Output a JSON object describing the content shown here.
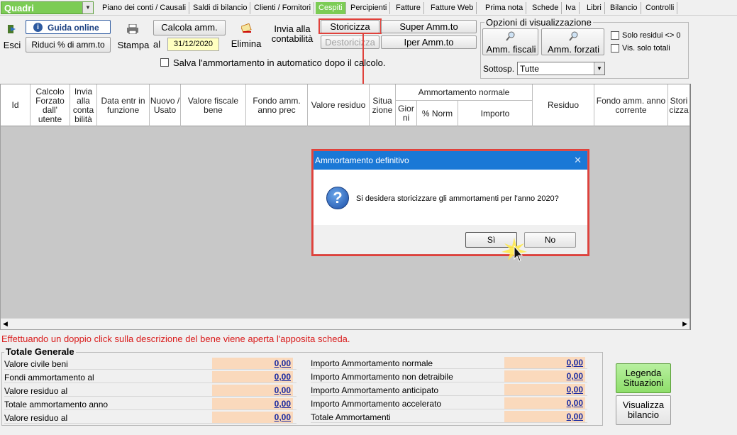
{
  "menu": {
    "quadri": "Quadri",
    "items": [
      "Piano dei conti / Causali",
      "Saldi di bilancio",
      "Clienti / Fornitori",
      "Cespiti",
      "Percipienti",
      "Fatture",
      "Fatture Web",
      "Prima nota",
      "Schede",
      "Iva",
      "Libri",
      "Bilancio",
      "Controlli"
    ],
    "active": "Cespiti"
  },
  "toolbar": {
    "esci": "Esci",
    "guida": "Guida online",
    "riduci": "Riduci % di amm.to",
    "stampa": "Stampa",
    "calcola": "Calcola amm.",
    "al": "al",
    "date": "31/12/2020",
    "elimina": "Elimina",
    "invia": "Invia alla contabilità",
    "storicizza": "Storicizza",
    "destoricizza": "Destoricizza",
    "super": "Super Amm.to",
    "iper": "Iper Amm.to",
    "salva_check": "Salva l'ammortamento in automatico dopo il calcolo."
  },
  "opzioni": {
    "title": "Opzioni di visualizzazione",
    "fiscali": "Amm. fiscali",
    "forzati": "Amm. forzati",
    "solo_residui": "Solo residui <> 0",
    "solo_totali": "Vis. solo totali",
    "sottosp_label": "Sottosp.",
    "sottosp_value": "Tutte"
  },
  "table": {
    "columns": {
      "id": "Id",
      "calcolo": "Calcolo Forzato dall' utente",
      "invia": "Invia alla conta bilità",
      "data": "Data entr in funzione",
      "nuovo": "Nuovo / Usato",
      "valore_fiscale": "Valore fiscale bene",
      "fondo_prec": "Fondo amm. anno prec",
      "valore_residuo": "Valore residuo",
      "situazione": "Situa zione",
      "amm_normale": "Ammortamento normale",
      "giorni": "Gior ni",
      "perc_norm": "% Norm",
      "importo": "Importo",
      "residuo": "Residuo",
      "fondo_corrente": "Fondo amm. anno corrente",
      "storicizza": "Stori cizza"
    }
  },
  "dialog": {
    "title": "Ammortamento definitivo",
    "message": "Si desidera storicizzare gli ammortamenti per l'anno 2020?",
    "yes": "Sì",
    "no": "No",
    "close": "✕"
  },
  "hint": "Effettuando un doppio click sulla descrizione del bene viene aperta l'apposita scheda.",
  "totals": {
    "title": "Totale Generale",
    "left": [
      {
        "label": "Valore civile beni",
        "value": "0,00"
      },
      {
        "label": "Fondi ammortamento al",
        "value": "0,00"
      },
      {
        "label": "Valore residuo al",
        "value": "0,00"
      },
      {
        "label": "Totale ammortamento anno",
        "value": "0,00"
      },
      {
        "label": "Valore residuo al",
        "value": "0,00"
      }
    ],
    "right": [
      {
        "label": "Importo Ammortamento normale",
        "value": "0,00"
      },
      {
        "label": "Importo Ammortamento non detraibile",
        "value": "0,00"
      },
      {
        "label": "Importo Ammortamento anticipato",
        "value": "0,00"
      },
      {
        "label": "Importo Ammortamento accelerato",
        "value": "0,00"
      },
      {
        "label": "Totale Ammortamenti",
        "value": "0,00"
      }
    ]
  },
  "side_buttons": {
    "legenda": "Legenda Situazioni",
    "visualizza": "Visualizza bilancio"
  },
  "colors": {
    "accent_green": "#7ccc55",
    "highlight_red": "#e0413b",
    "title_blue": "#1a78d6",
    "value_bg": "#fad9bc"
  }
}
